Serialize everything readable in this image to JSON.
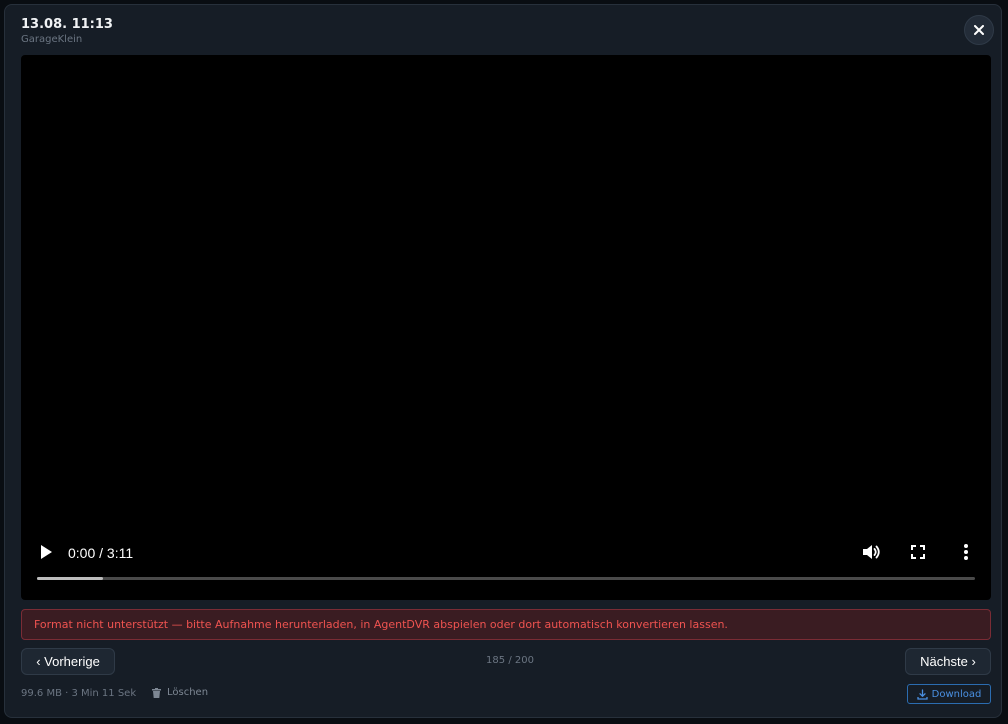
{
  "header": {
    "title": "13.08. 11:13",
    "camera_name": "GarageKlein",
    "close_icon": "close-icon"
  },
  "player": {
    "time": "0:00 / 3:11",
    "progress": 0.07,
    "controls": [
      "play-icon",
      "volume-icon",
      "fullscreen-icon",
      "more-vertical-icon"
    ]
  },
  "error": {
    "message": "Format nicht unterstützt — bitte Aufnahme herunterladen, in AgentDVR abspielen oder dort automatisch konvertieren lassen."
  },
  "navigation": {
    "prev_label": "‹ Vorherige",
    "next_label": "Nächste ›",
    "counter": "185 / 200"
  },
  "footer": {
    "meta": "99.6 MB · 3 Min 11 Sek",
    "delete_label": "Löschen",
    "download_label": "Download"
  },
  "colors": {
    "modal_bg": "#161d26",
    "error_text": "#ef5350",
    "accent": "#4a90e2"
  }
}
